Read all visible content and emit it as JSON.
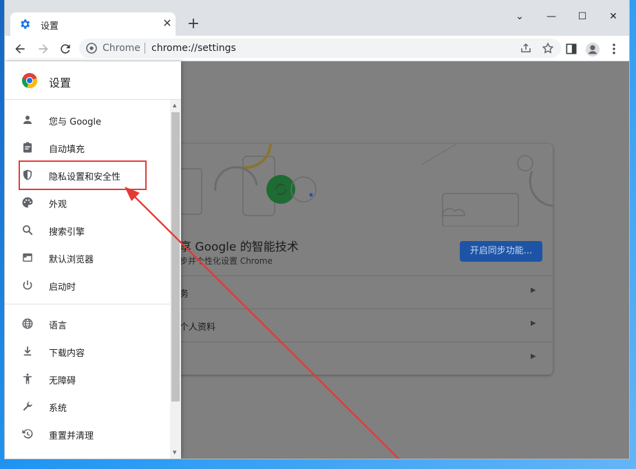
{
  "browser": {
    "tab": {
      "title": "设置",
      "icon": "gear-icon",
      "close": "✕"
    },
    "new_tab": "+",
    "window_controls": {
      "minimize": "⌄",
      "restore": "—",
      "maximize": "☐",
      "close": "✕"
    },
    "omnibox": {
      "site_name": "Chrome",
      "url": "chrome://settings"
    }
  },
  "sidebar": {
    "title": "设置",
    "items": [
      {
        "label": "您与 Google",
        "icon": "person-icon"
      },
      {
        "label": "自动填充",
        "icon": "clipboard-icon"
      },
      {
        "label": "隐私设置和安全性",
        "icon": "shield-icon"
      },
      {
        "label": "外观",
        "icon": "palette-icon"
      },
      {
        "label": "搜索引擎",
        "icon": "search-icon"
      },
      {
        "label": "默认浏览器",
        "icon": "browser-window-icon"
      },
      {
        "label": "启动时",
        "icon": "power-icon"
      },
      {
        "label": "语言",
        "icon": "globe-icon"
      },
      {
        "label": "下载内容",
        "icon": "download-icon"
      },
      {
        "label": "无障碍",
        "icon": "accessibility-icon"
      },
      {
        "label": "系统",
        "icon": "wrench-icon"
      },
      {
        "label": "重置并清理",
        "icon": "restore-icon"
      }
    ]
  },
  "main": {
    "sync_card": {
      "title": "享 Google 的智能技术",
      "subtitle": "步并个性化设置 Chrome",
      "button": "开启同步功能...",
      "rows": [
        "务",
        "个人资料",
        ""
      ]
    }
  },
  "colors": {
    "annotation": "#e53935",
    "sync_button": "#1d54a6"
  }
}
